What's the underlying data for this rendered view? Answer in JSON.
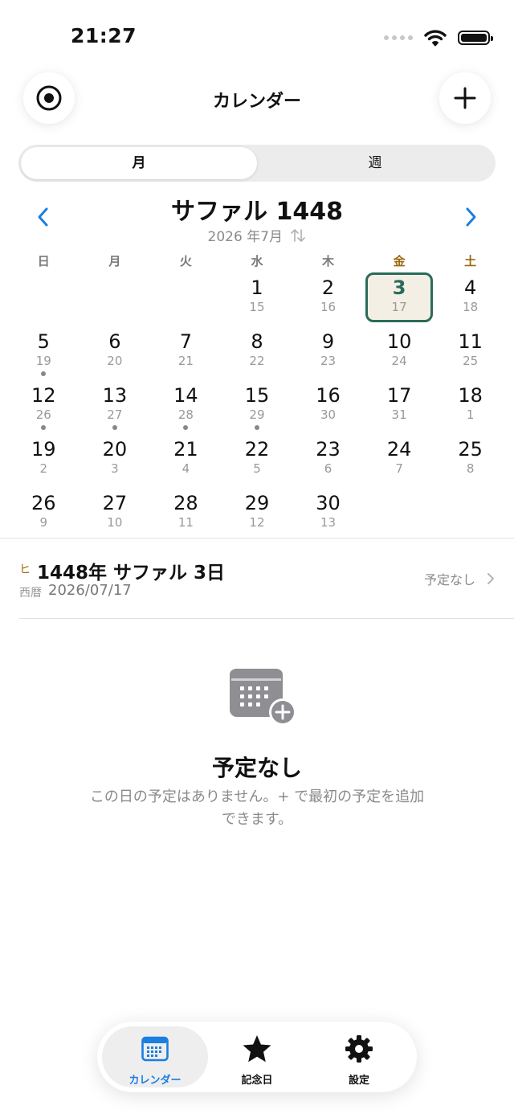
{
  "status_bar": {
    "time": "21:27"
  },
  "nav": {
    "title": "カレンダー"
  },
  "segment": {
    "month_label": "月",
    "week_label": "週"
  },
  "month_header": {
    "hijri_title": "サファル 1448",
    "gregorian_sub": "2026 年7月"
  },
  "weekdays": [
    "日",
    "月",
    "火",
    "水",
    "木",
    "金",
    "土"
  ],
  "calendar": [
    [
      null,
      null,
      null,
      {
        "h": "1",
        "g": "15"
      },
      {
        "h": "2",
        "g": "16"
      },
      {
        "h": "3",
        "g": "17",
        "selected": true
      },
      {
        "h": "4",
        "g": "18"
      }
    ],
    [
      {
        "h": "5",
        "g": "19",
        "dot": true
      },
      {
        "h": "6",
        "g": "20"
      },
      {
        "h": "7",
        "g": "21"
      },
      {
        "h": "8",
        "g": "22"
      },
      {
        "h": "9",
        "g": "23"
      },
      {
        "h": "10",
        "g": "24"
      },
      {
        "h": "11",
        "g": "25"
      }
    ],
    [
      {
        "h": "12",
        "g": "26",
        "dot": true
      },
      {
        "h": "13",
        "g": "27",
        "dot": true
      },
      {
        "h": "14",
        "g": "28",
        "dot": true
      },
      {
        "h": "15",
        "g": "29",
        "dot": true
      },
      {
        "h": "16",
        "g": "30"
      },
      {
        "h": "17",
        "g": "31"
      },
      {
        "h": "18",
        "g": "1"
      }
    ],
    [
      {
        "h": "19",
        "g": "2"
      },
      {
        "h": "20",
        "g": "3"
      },
      {
        "h": "21",
        "g": "4"
      },
      {
        "h": "22",
        "g": "5"
      },
      {
        "h": "23",
        "g": "6"
      },
      {
        "h": "24",
        "g": "7"
      },
      {
        "h": "25",
        "g": "8"
      }
    ],
    [
      {
        "h": "26",
        "g": "9"
      },
      {
        "h": "27",
        "g": "10"
      },
      {
        "h": "28",
        "g": "11"
      },
      {
        "h": "29",
        "g": "12"
      },
      {
        "h": "30",
        "g": "13"
      },
      null,
      null
    ]
  ],
  "selected_day": {
    "badge": "ヒ",
    "hijri": "1448年 サファル 3日",
    "gregorian_label": "西暦",
    "gregorian": "2026/07/17",
    "events_status": "予定なし"
  },
  "empty_state": {
    "title": "予定なし",
    "description": "この日の予定はありません。+ で最初の予定を追加できます。"
  },
  "tabbar": {
    "calendar": "カレンダー",
    "anniversary": "記念日",
    "settings": "設定"
  },
  "colors": {
    "accent_blue": "#1a7fe0",
    "selected_green": "#2a6b5b",
    "weekend_gold": "#9a6a10",
    "selected_bg": "#f4efe4"
  }
}
